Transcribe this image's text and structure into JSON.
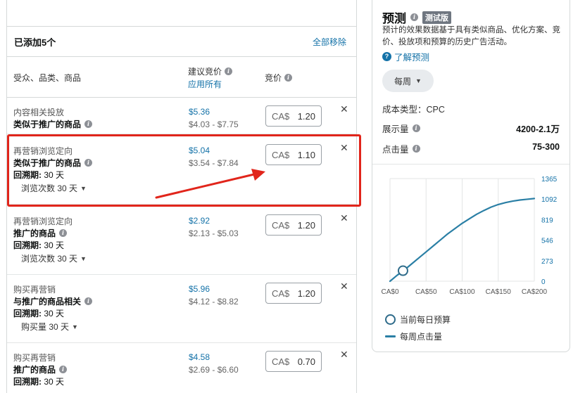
{
  "list": {
    "added_label": "已添加5个",
    "remove_all": "全部移除",
    "col_targeting": "受众、品类、商品",
    "col_suggested": "建议竞价",
    "apply_all": "应用所有",
    "col_bid": "竞价",
    "currency": "CA$",
    "lookback_label": "回溯期:",
    "rows": [
      {
        "type": "内容相关投放",
        "name": "类似于推广的商品",
        "lookback": "",
        "dropdown": "",
        "price": "$5.36",
        "range": "$4.03 - $7.75",
        "bid": "1.20"
      },
      {
        "type": "再营销浏览定向",
        "name": "类似于推广的商品",
        "lookback": "30 天",
        "dropdown": "浏览次数 30 天",
        "price": "$5.04",
        "range": "$3.54 - $7.84",
        "bid": "1.10"
      },
      {
        "type": "再营销浏览定向",
        "name": "推广的商品",
        "lookback": "30 天",
        "dropdown": "浏览次数 30 天",
        "price": "$2.92",
        "range": "$2.13 - $5.03",
        "bid": "1.20"
      },
      {
        "type": "购买再营销",
        "name": "与推广的商品相关",
        "lookback": "30 天",
        "dropdown": "购买量 30 天",
        "price": "$5.96",
        "range": "$4.12 - $8.82",
        "bid": "1.20"
      },
      {
        "type": "购买再营销",
        "name": "推广的商品",
        "lookback": "30 天",
        "dropdown": "",
        "price": "$4.58",
        "range": "$2.69 - $6.60",
        "bid": "0.70"
      }
    ]
  },
  "forecast": {
    "title": "预测",
    "beta": "测试版",
    "description": "预计的效果数据基于具有类似商品、优化方案、竞价、投放项和预算的历史广告活动。",
    "learn_more": "了解预测",
    "period": "每周",
    "cost_type": "成本类型：CPC",
    "impressions_label": "展示量",
    "impressions_value": "4200-2.1万",
    "clicks_label": "点击量",
    "clicks_value": "75-300",
    "legend_budget": "当前每日预算",
    "legend_clicks": "每周点击量"
  },
  "colors": {
    "accent": "#1472a8",
    "highlight": "#e1251b",
    "curve": "#2a7fa5"
  },
  "chart_data": {
    "type": "line",
    "x_ticks": [
      "CA$0",
      "CA$50",
      "CA$100",
      "CA$150",
      "CA$200"
    ],
    "y_ticks": [
      "0",
      "273",
      "546",
      "819",
      "1092",
      "1365"
    ],
    "xlim": [
      0,
      200
    ],
    "ylim": [
      0,
      1365
    ],
    "x": [
      0,
      10,
      20,
      30,
      40,
      50,
      60,
      70,
      80,
      90,
      100,
      110,
      120,
      130,
      140,
      150,
      160,
      170,
      180,
      190,
      200
    ],
    "y": [
      0,
      80,
      150,
      230,
      310,
      390,
      470,
      550,
      630,
      700,
      770,
      830,
      890,
      940,
      985,
      1020,
      1045,
      1065,
      1080,
      1090,
      1100
    ],
    "marker": {
      "x": 18,
      "y": 140
    },
    "grid": true
  }
}
